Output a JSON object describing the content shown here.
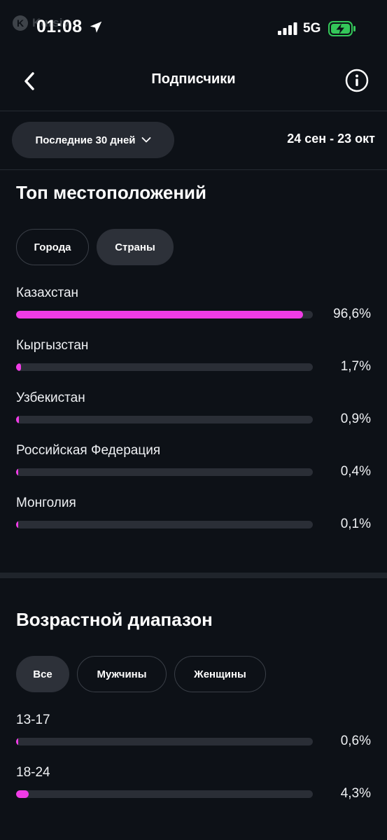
{
  "status_bar": {
    "watermark": "Kursiv",
    "time": "01:08",
    "network": "5G",
    "battery_color": "#34c759"
  },
  "header": {
    "title": "Подписчики",
    "back_icon": "chevron-left-icon",
    "info_icon": "info-circle-icon"
  },
  "filter": {
    "period_label": "Последние 30 дней",
    "date_range": "24 сен - 23 окт"
  },
  "locations": {
    "title": "Топ местоположений",
    "tabs": [
      {
        "label": "Города",
        "selected": false
      },
      {
        "label": "Страны",
        "selected": true
      }
    ],
    "items": [
      {
        "label": "Казахстан",
        "value": "96,6%",
        "percent": 96.6
      },
      {
        "label": "Кыргызстан",
        "value": "1,7%",
        "percent": 1.7
      },
      {
        "label": "Узбекистан",
        "value": "0,9%",
        "percent": 0.9
      },
      {
        "label": "Российская Федерация",
        "value": "0,4%",
        "percent": 0.4
      },
      {
        "label": "Монголия",
        "value": "0,1%",
        "percent": 0.1
      }
    ]
  },
  "age": {
    "title": "Возрастной диапазон",
    "tabs": [
      {
        "label": "Все",
        "selected": true
      },
      {
        "label": "Мужчины",
        "selected": false
      },
      {
        "label": "Женщины",
        "selected": false
      }
    ],
    "items": [
      {
        "label": "13-17",
        "value": "0,6%",
        "percent": 0.6
      },
      {
        "label": "18-24",
        "value": "4,3%",
        "percent": 4.3
      }
    ]
  },
  "colors": {
    "accent": "#f03ce6",
    "track": "#2a2e36",
    "background": "#0d1117"
  }
}
